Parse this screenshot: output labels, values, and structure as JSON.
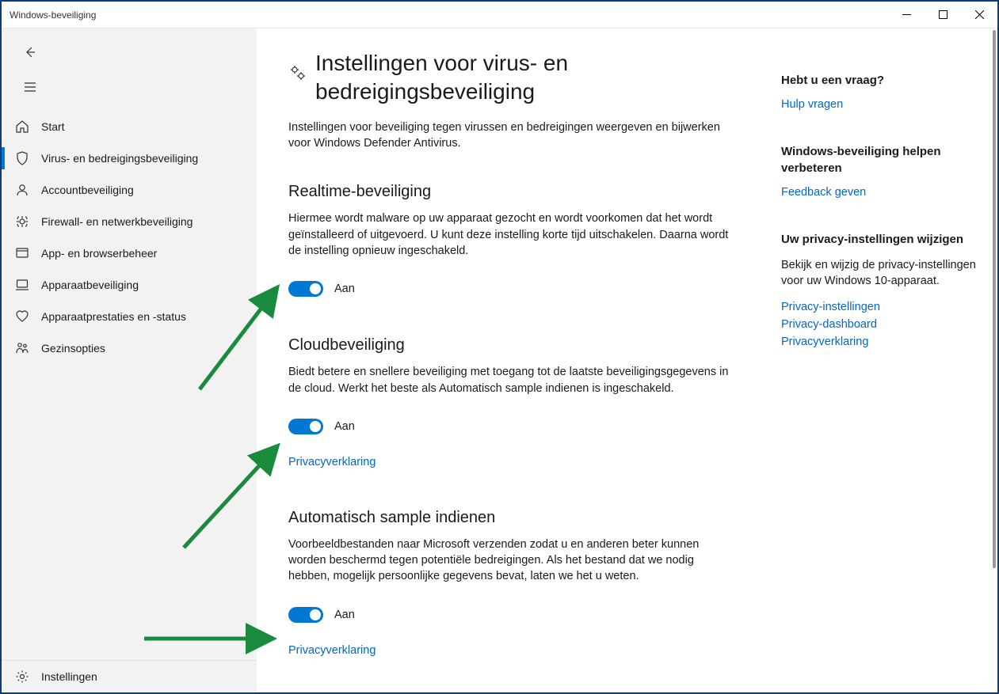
{
  "window": {
    "title": "Windows-beveiliging"
  },
  "sidebar": {
    "items": [
      {
        "id": "start",
        "label": "Start"
      },
      {
        "id": "virus",
        "label": "Virus- en bedreigingsbeveiliging"
      },
      {
        "id": "account",
        "label": "Accountbeveiliging"
      },
      {
        "id": "firewall",
        "label": "Firewall- en netwerkbeveiliging"
      },
      {
        "id": "app-browser",
        "label": "App- en browserbeheer"
      },
      {
        "id": "device",
        "label": "Apparaatbeveiliging"
      },
      {
        "id": "performance",
        "label": "Apparaatprestaties en -status"
      },
      {
        "id": "family",
        "label": "Gezinsopties"
      }
    ],
    "settings_label": "Instellingen"
  },
  "page": {
    "title": "Instellingen voor virus- en bedreigingsbeveiliging",
    "description": "Instellingen voor beveiliging tegen virussen en bedreigingen weergeven en bijwerken voor Windows Defender Antivirus."
  },
  "sections": {
    "realtime": {
      "title": "Realtime-beveiliging",
      "description": "Hiermee wordt malware op uw apparaat gezocht en wordt voorkomen dat het wordt geïnstalleerd of uitgevoerd. U kunt deze instelling korte tijd uitschakelen. Daarna wordt de instelling opnieuw ingeschakeld.",
      "toggle_state": "Aan"
    },
    "cloud": {
      "title": "Cloudbeveiliging",
      "description": "Biedt betere en snellere beveiliging met toegang tot de laatste beveiligingsgegevens in de cloud. Werkt het beste als Automatisch sample indienen is ingeschakeld.",
      "toggle_state": "Aan",
      "privacy_link": "Privacyverklaring"
    },
    "sample": {
      "title": "Automatisch sample indienen",
      "description": "Voorbeeldbestanden naar Microsoft verzenden zodat u en anderen beter kunnen worden beschermd tegen potentiële bedreigingen. Als het bestand dat we nodig hebben, mogelijk persoonlijke gegevens bevat, laten we het u weten.",
      "toggle_state": "Aan",
      "privacy_link": "Privacyverklaring"
    }
  },
  "aside": {
    "question": {
      "title": "Hebt u een vraag?",
      "help_link": "Hulp vragen"
    },
    "improve": {
      "title": "Windows-beveiliging helpen verbeteren",
      "feedback_link": "Feedback geven"
    },
    "privacy": {
      "title": "Uw privacy-instellingen wijzigen",
      "description": "Bekijk en wijzig de privacy-instellingen voor uw Windows 10-apparaat.",
      "links": {
        "settings": "Privacy-instellingen",
        "dashboard": "Privacy-dashboard",
        "statement": "Privacyverklaring"
      }
    }
  }
}
